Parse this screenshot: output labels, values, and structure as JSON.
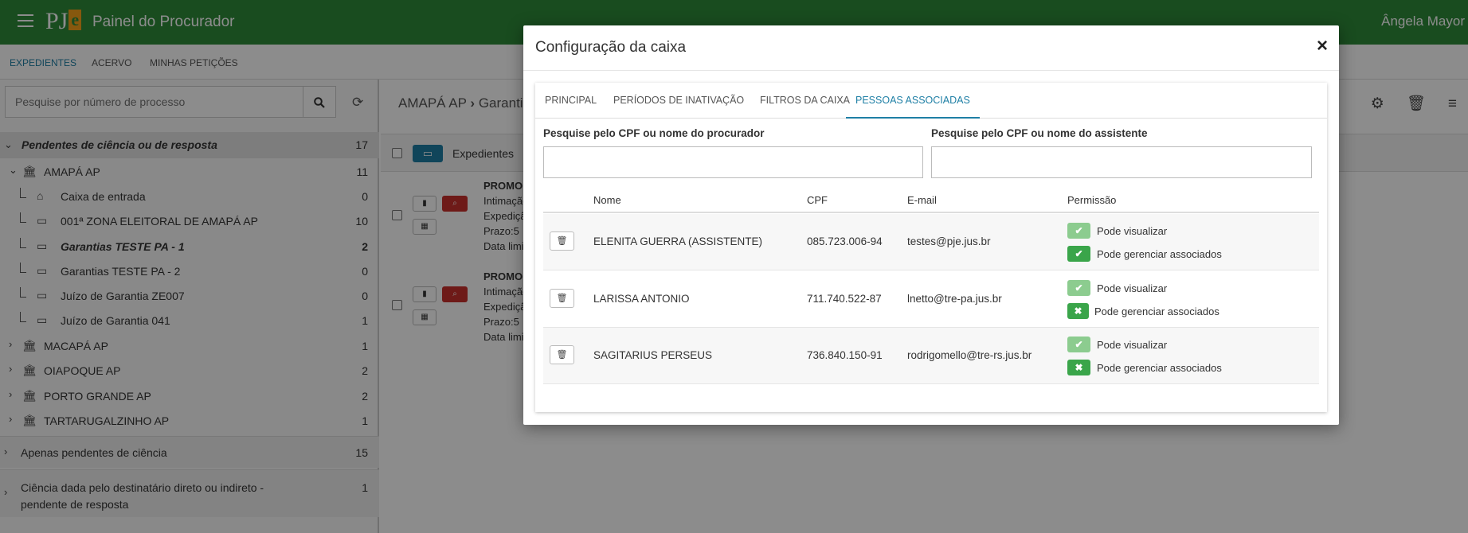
{
  "topbar": {
    "logo_main": "PJ",
    "logo_accent": "e",
    "title": "Painel do Procurador",
    "user": "Ângela Mayor"
  },
  "subnav": [
    "EXPEDIENTES",
    "ACERVO",
    "MINHAS PETIÇÕES"
  ],
  "left": {
    "search_placeholder": "Pesquise por número de processo",
    "tree": [
      {
        "label": "Pendentes de ciência ou de resposta",
        "count": "17"
      },
      {
        "label": "AMAPÁ AP",
        "count": "11"
      },
      {
        "label": "Caixa de entrada",
        "count": "0"
      },
      {
        "label": "001ª ZONA ELEITORAL DE AMAPÁ AP",
        "count": "10"
      },
      {
        "label": "Garantias TESTE PA - 1",
        "count": "2"
      },
      {
        "label": "Garantias TESTE PA - 2",
        "count": "0"
      },
      {
        "label": "Juízo de Garantia ZE007",
        "count": "0"
      },
      {
        "label": "Juízo de Garantia 041",
        "count": "1"
      },
      {
        "label": "MACAPÁ AP",
        "count": "1"
      },
      {
        "label": "OIAPOQUE AP",
        "count": "2"
      },
      {
        "label": "PORTO GRANDE AP",
        "count": "2"
      },
      {
        "label": "TARTARUGALZINHO AP",
        "count": "1"
      },
      {
        "label": "Apenas pendentes de ciência",
        "count": "15"
      },
      {
        "label": "Ciência dada pelo destinatário direto ou indireto -",
        "count": "1"
      },
      {
        "label": "pendente de resposta",
        "count": ""
      }
    ]
  },
  "main": {
    "breadcrumb_a": "AMAPÁ AP",
    "breadcrumb_sep": "›",
    "breadcrumb_b": "Garantia",
    "list_label": "Expedientes",
    "items": [
      {
        "title": "PROMO",
        "l1": "Intimação",
        "l2": "Expedição",
        "l3": "Prazo:5",
        "l4": "Data limi"
      },
      {
        "title": "PROMO",
        "l1": "Intimação",
        "l2": "Expedição",
        "l3": "Prazo:5",
        "l4": "Data limi"
      }
    ]
  },
  "modal": {
    "title": "Configuração da caixa",
    "close": "×",
    "tabs": [
      "PRINCIPAL",
      "PERÍODOS DE INATIVAÇÃO",
      "FILTROS DA CAIXA",
      "PESSOAS ASSOCIADAS"
    ],
    "active_tab": "PESSOAS ASSOCIADAS",
    "label_procurador": "Pesquise pelo CPF ou nome do procurador",
    "label_assistente": "Pesquise pelo CPF ou nome do assistente",
    "columns": [
      "Nome",
      "CPF",
      "E-mail",
      "Permissão"
    ],
    "rows": [
      {
        "nome": "ELENITA GUERRA (ASSISTENTE)",
        "cpf": "085.723.006-94",
        "email": "testes@pje.jus.br",
        "view": "Pode visualizar",
        "manage": "Pode gerenciar associados",
        "view_on": true,
        "manage_on": true
      },
      {
        "nome": "LARISSA ANTONIO",
        "cpf": "711.740.522-87",
        "email": "lnetto@tre-pa.jus.br",
        "view": "Pode visualizar",
        "manage": "Pode gerenciar associados",
        "view_on": true,
        "manage_on": false
      },
      {
        "nome": "SAGITARIUS PERSEUS",
        "cpf": "736.840.150-91",
        "email": "rodrigomello@tre-rs.jus.br",
        "view": "Pode visualizar",
        "manage": "Pode gerenciar associados",
        "view_on": true,
        "manage_on": false
      }
    ]
  },
  "colors": {
    "topbar": "#2e8b3a",
    "accent": "#1e7fa5",
    "danger": "#c9302c",
    "check_light": "#8ccc8f",
    "check_dark": "#3aa54a"
  }
}
